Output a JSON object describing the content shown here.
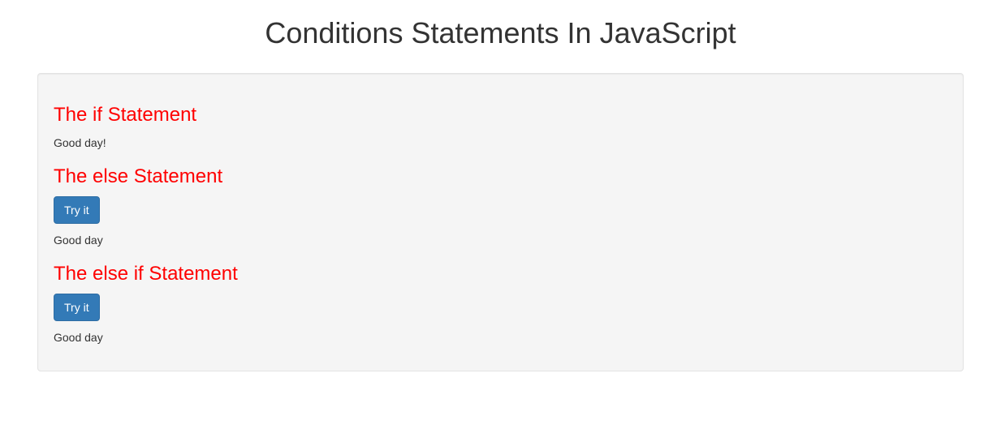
{
  "page": {
    "title": "Conditions Statements In JavaScript"
  },
  "sections": {
    "if": {
      "heading": "The if Statement",
      "output": "Good day!"
    },
    "else": {
      "heading": "The else Statement",
      "button_label": "Try it",
      "output": "Good day"
    },
    "elseif": {
      "heading": "The else if Statement",
      "button_label": "Try it",
      "output": "Good day"
    }
  }
}
